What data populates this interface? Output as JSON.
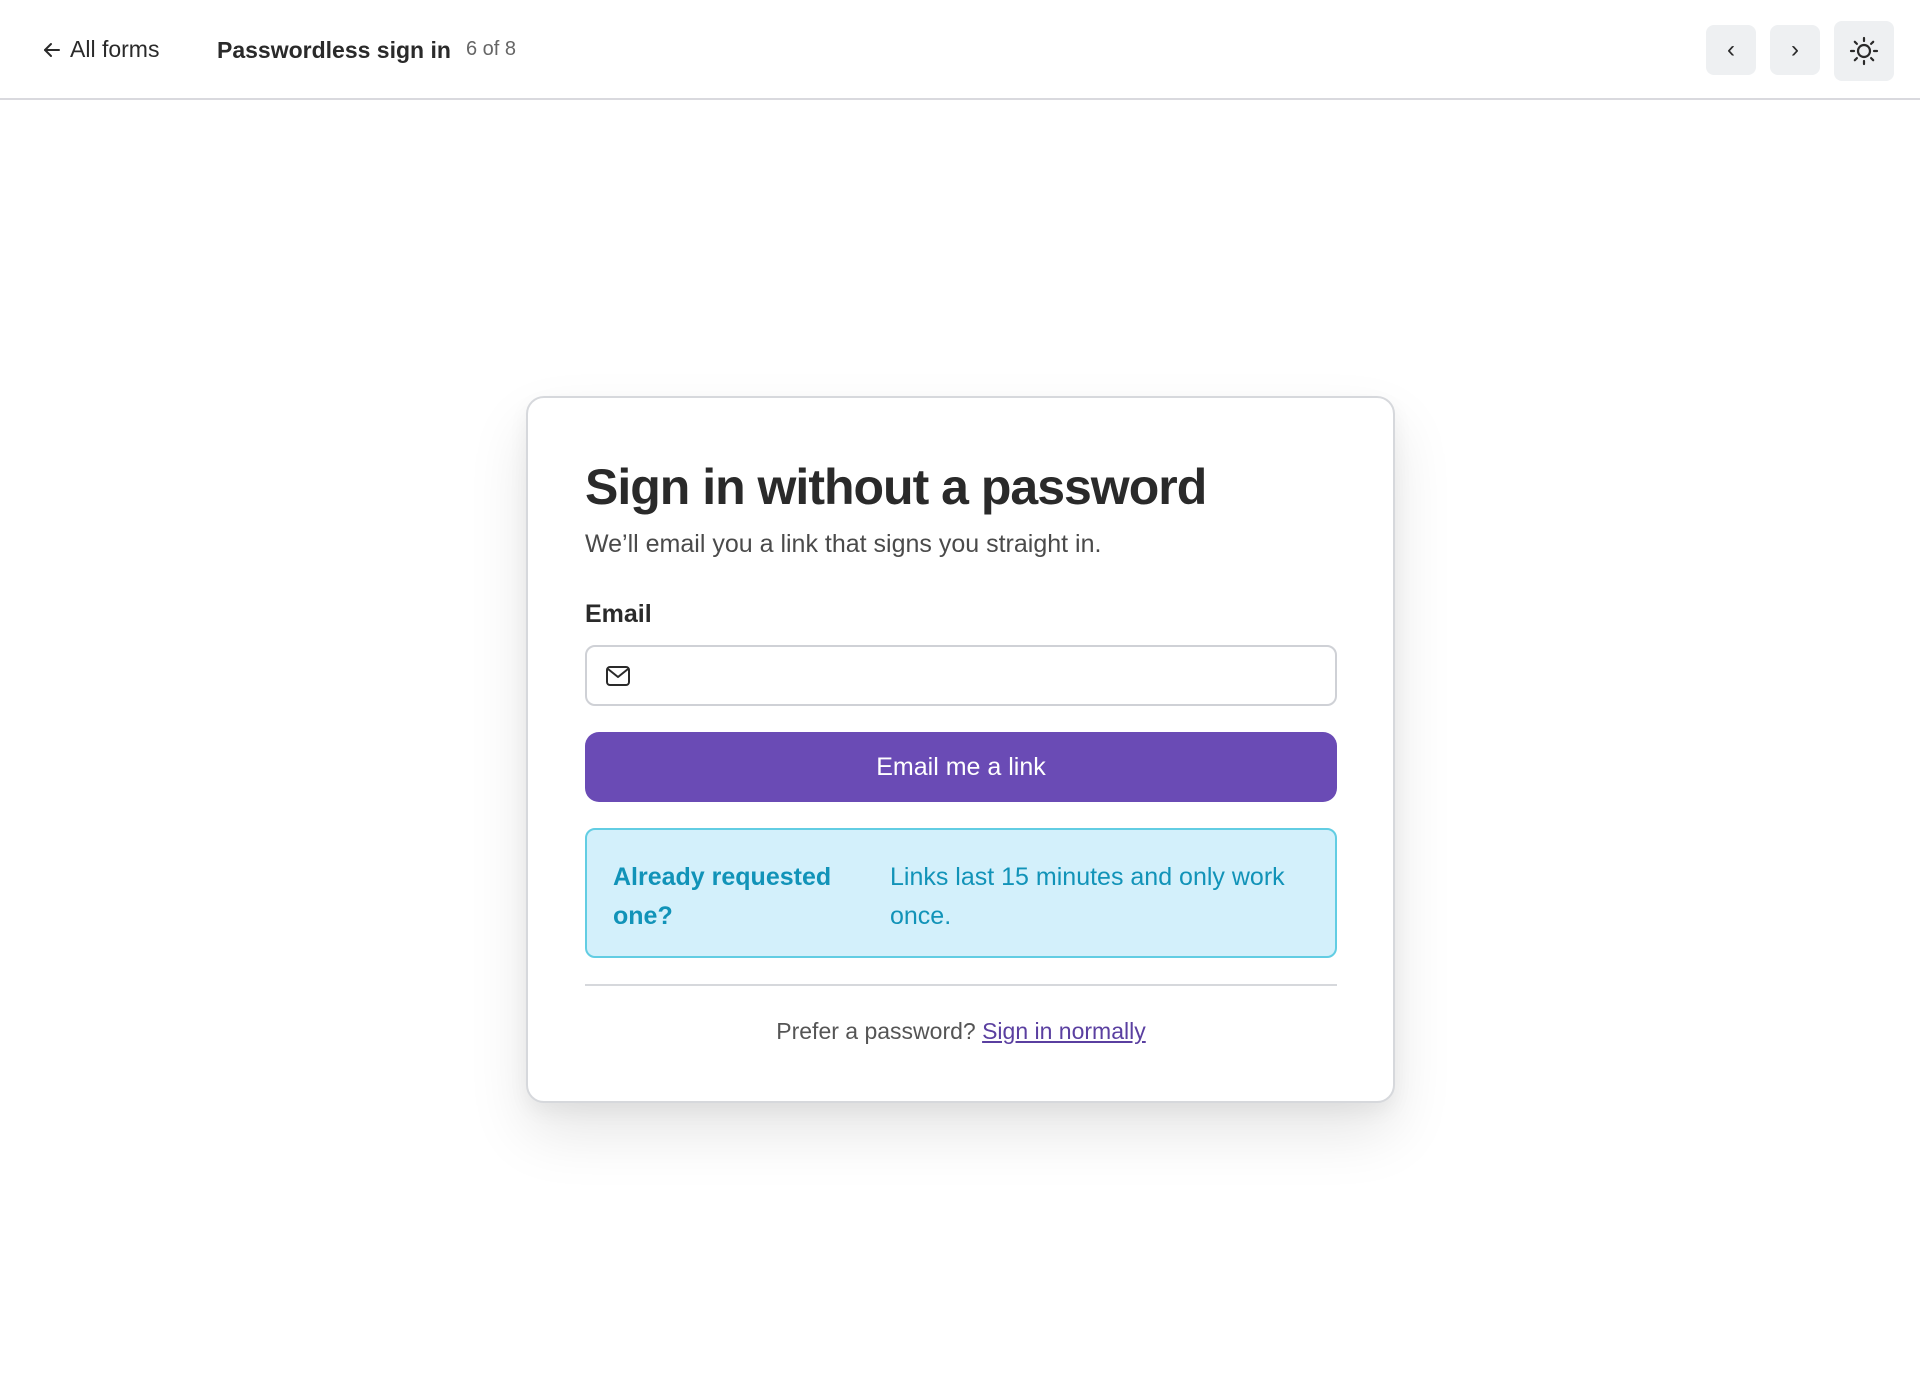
{
  "topbar": {
    "back_label": "All forms",
    "form_title": "Passwordless sign in",
    "counter": "6 of 8",
    "prev_label": "‹",
    "next_label": "›"
  },
  "card": {
    "heading": "Sign in without a password",
    "subheading": "We’ll email you a link that signs you straight in.",
    "email_label": "Email",
    "email_value": "",
    "email_placeholder": "",
    "submit_label": "Email me a link",
    "notice": {
      "title": "Already requested one?",
      "body": "Links last 15 minutes and only work once."
    },
    "footer_text": "Prefer a password?",
    "footer_link": "Sign in normally"
  },
  "icons": {
    "back": "arrow-left-icon",
    "mail": "mail-icon",
    "theme": "sun-icon"
  },
  "colors": {
    "primary": "#6a4bb5",
    "notice_bg": "#d3f0fb",
    "notice_border": "#62cde3",
    "notice_text": "#1193b8",
    "link": "#5a3fa0"
  }
}
